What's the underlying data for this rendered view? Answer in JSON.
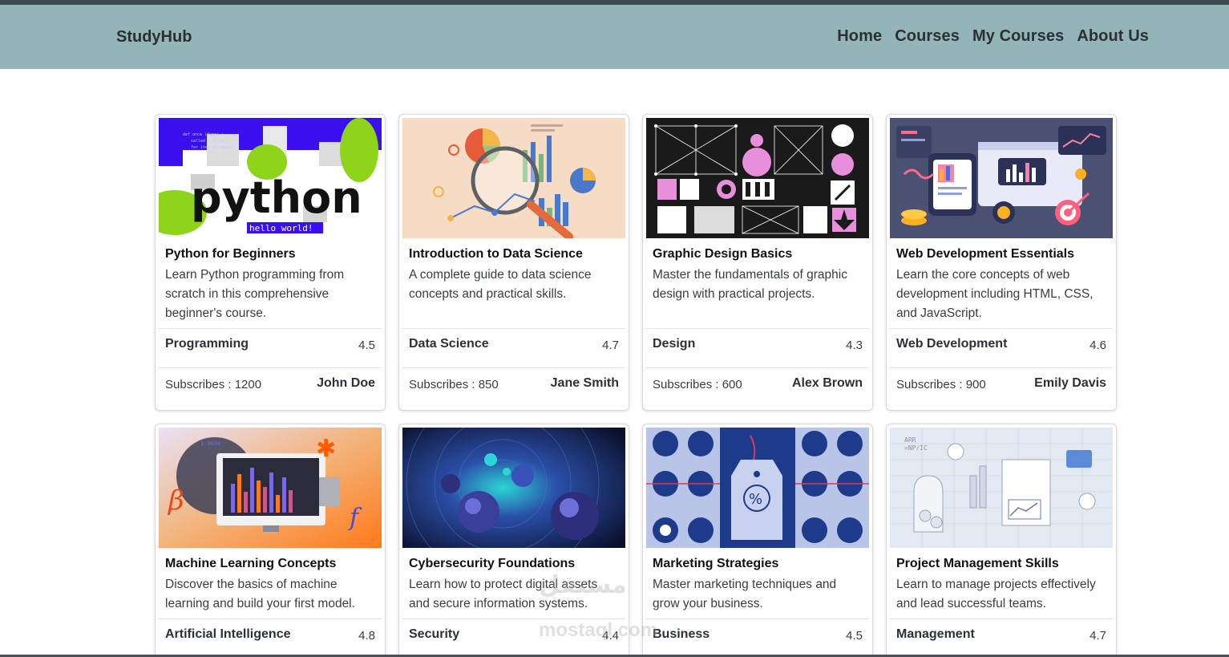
{
  "navbar": {
    "brand": "StudyHub",
    "links": [
      "Home",
      "Courses",
      "My Courses",
      "About Us"
    ]
  },
  "courses": [
    {
      "title": "Python for Beginners",
      "description": "Learn Python programming from scratch in this comprehensive beginner's course.",
      "category": "Programming",
      "rating": "4.5",
      "subscribers": "Subscribes : 1200",
      "author": "John Doe",
      "image_text": "python",
      "image_subtext": "hello world!"
    },
    {
      "title": "Introduction to Data Science",
      "description": "A complete guide to data science concepts and practical skills.",
      "category": "Data Science",
      "rating": "4.7",
      "subscribers": "Subscribes : 850",
      "author": "Jane Smith"
    },
    {
      "title": "Graphic Design Basics",
      "description": "Master the fundamentals of graphic design with practical projects.",
      "category": "Design",
      "rating": "4.3",
      "subscribers": "Subscribes : 600",
      "author": "Alex Brown"
    },
    {
      "title": "Web Development Essentials",
      "description": "Learn the core concepts of web development including HTML, CSS, and JavaScript.",
      "category": "Web Development",
      "rating": "4.6",
      "subscribers": "Subscribes : 900",
      "author": "Emily Davis"
    },
    {
      "title": "Machine Learning Concepts",
      "description": "Discover the basics of machine learning and build your first model.",
      "category": "Artificial Intelligence",
      "rating": "4.8"
    },
    {
      "title": "Cybersecurity Foundations",
      "description": "Learn how to protect digital assets and secure information systems.",
      "category": "Security",
      "rating": "4.4"
    },
    {
      "title": "Marketing Strategies",
      "description": "Master marketing techniques and grow your business.",
      "category": "Business",
      "rating": "4.5"
    },
    {
      "title": "Project Management Skills",
      "description": "Learn to manage projects effectively and lead successful teams.",
      "category": "Management",
      "rating": "4.7"
    }
  ],
  "watermark": {
    "arabic": "مستقل",
    "latin": "mostaql.com"
  },
  "icons": [
    "python-thumbnail",
    "data-science-thumbnail",
    "graphic-design-thumbnail",
    "web-dev-thumbnail",
    "machine-learning-thumbnail",
    "cybersecurity-thumbnail",
    "marketing-thumbnail",
    "project-management-thumbnail"
  ]
}
